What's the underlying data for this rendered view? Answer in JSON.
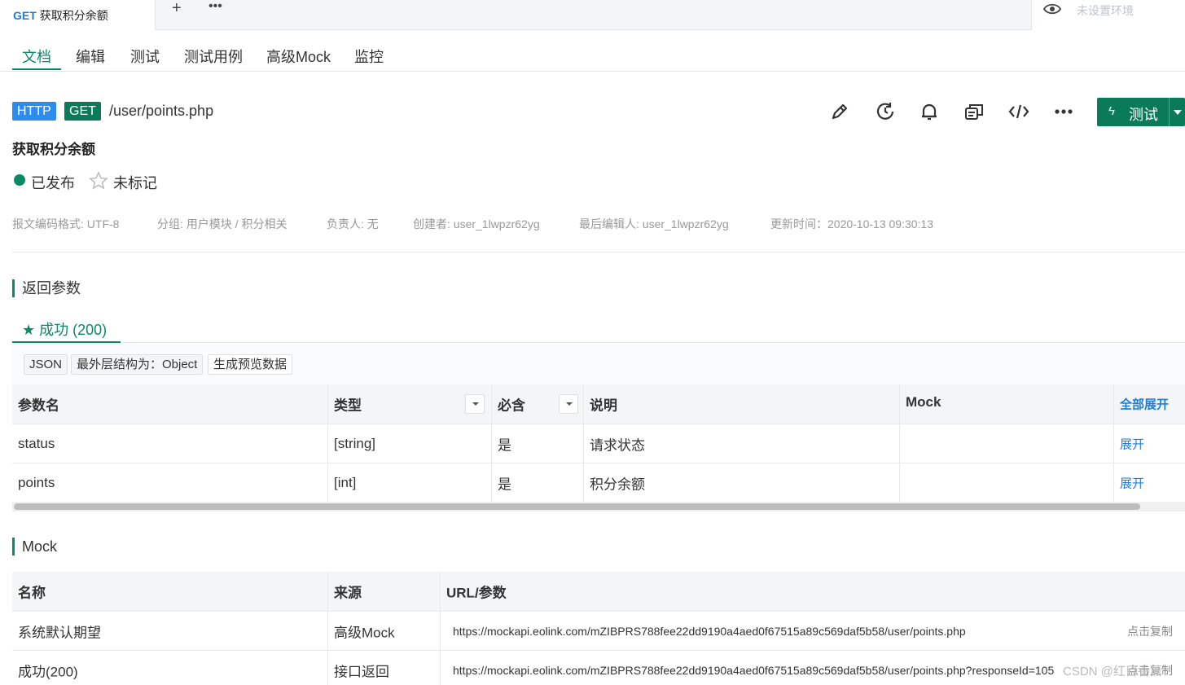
{
  "tabstrip": {
    "active_tab": {
      "method": "GET",
      "name": "获取积分余额"
    },
    "add_icon": "plus-icon",
    "more_icon": "ellipsis-icon",
    "environment": {
      "icon": "eye-icon",
      "label": "未设置环境"
    }
  },
  "subnav": {
    "items": [
      "文档",
      "编辑",
      "测试",
      "测试用例",
      "高级Mock",
      "监控"
    ],
    "active": "文档"
  },
  "api": {
    "protocol": "HTTP",
    "method": "GET",
    "path": "/user/points.php",
    "title": "获取积分余额",
    "status": "已发布",
    "mark": "未标记",
    "toolbar_icons": [
      "edit-icon",
      "history-icon",
      "bell-icon",
      "copy-icon",
      "code-icon",
      "more-icon"
    ],
    "test_button": "测试"
  },
  "meta": {
    "encoding": "报文编码格式: UTF-8",
    "group": "分组: 用户模块 / 积分相关",
    "owner": "负责人: 无",
    "creator": "创建者: user_1lwpzr62yg",
    "last_editor": "最后编辑人: user_1lwpzr62yg",
    "updated": "更新时间：2020-10-13 09:30:13"
  },
  "response": {
    "section_title": "返回参数",
    "tab": "成功 (200)",
    "tags": [
      "JSON",
      "最外层结构为：Object",
      "生成预览数据"
    ],
    "columns": [
      "参数名",
      "类型",
      "必含",
      "说明",
      "Mock",
      "全部展开"
    ],
    "rows": [
      {
        "name": "status",
        "type": "[string]",
        "required": "是",
        "desc": "请求状态",
        "mock": "",
        "action": "展开"
      },
      {
        "name": "points",
        "type": "[int]",
        "required": "是",
        "desc": "积分余额",
        "mock": "",
        "action": "展开"
      }
    ]
  },
  "mock": {
    "section_title": "Mock",
    "columns": [
      "名称",
      "来源",
      "URL/参数"
    ],
    "rows": [
      {
        "name": "系统默认期望",
        "source": "高级Mock",
        "url": "https://mockapi.eolink.com/mZIBPRS788fee22dd9190a4aed0f67515a89c569daf5b58/user/points.php",
        "action": "点击复制"
      },
      {
        "name": "成功(200)",
        "source": "接口返回",
        "url": "https://mockapi.eolink.com/mZIBPRS788fee22dd9190a4aed0f67515a89c569daf5b58/user/points.php?responseId=105",
        "action": "点击复制"
      }
    ]
  },
  "watermark": "CSDN @红目香薰",
  "colors": {
    "accent": "#0b8a66",
    "button": "#0b7a58",
    "http": "#2d8cf0",
    "link": "#1e7ee0"
  }
}
